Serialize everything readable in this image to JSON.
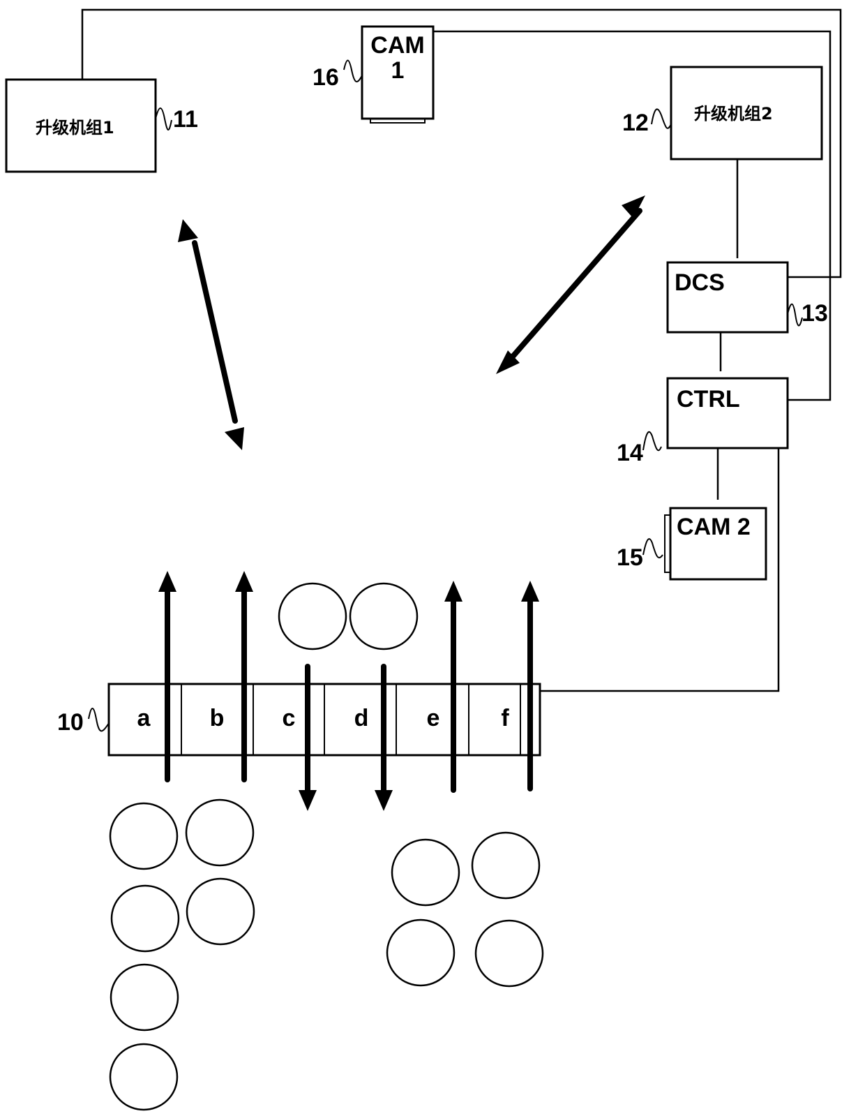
{
  "diagram": {
    "units": [
      {
        "id": "unit1",
        "label": "升级机组1",
        "ref": "11"
      },
      {
        "id": "unit2",
        "label": "升级机组2",
        "ref": "12"
      },
      {
        "id": "dcs",
        "label": "DCS",
        "ref": "13"
      },
      {
        "id": "ctrl",
        "label": "CTRL",
        "ref": "14"
      },
      {
        "id": "cam2",
        "label": "CAM 2",
        "ref": "15"
      },
      {
        "id": "cam1",
        "label_line1": "CAM",
        "label_line2": "1",
        "ref": "16"
      }
    ],
    "conveyor": {
      "ref": "10",
      "segments": [
        "a",
        "b",
        "c",
        "d",
        "e",
        "f"
      ],
      "flow_directions": [
        "up",
        "up",
        "down",
        "down",
        "up",
        "up"
      ]
    },
    "double_arrows": [
      {
        "from": "conveyor",
        "to": "unit1"
      },
      {
        "from": "conveyor",
        "to": "unit2"
      }
    ],
    "connections": [
      {
        "from": "unit1",
        "to": "dcs"
      },
      {
        "from": "cam1",
        "to": "ctrl"
      },
      {
        "from": "unit2",
        "to": "dcs"
      },
      {
        "from": "dcs",
        "to": "ctrl"
      },
      {
        "from": "ctrl",
        "to": "cam2"
      },
      {
        "from": "ctrl",
        "to": "conveyor"
      }
    ],
    "item_groups": [
      {
        "name": "upper-middle-items",
        "count": 2
      },
      {
        "name": "lower-left-items",
        "count": 6
      },
      {
        "name": "lower-right-items",
        "count": 4
      }
    ]
  }
}
